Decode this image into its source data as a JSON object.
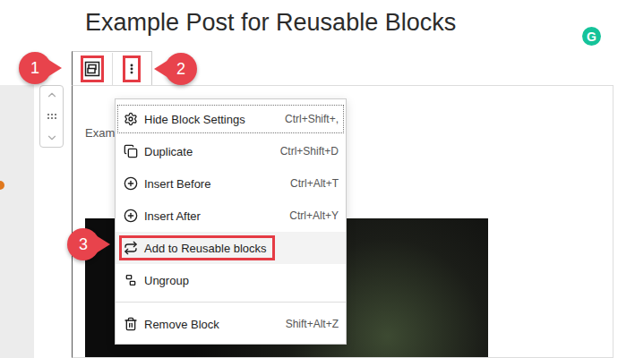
{
  "post": {
    "title": "Example Post for Reusable Blocks"
  },
  "grammarly": {
    "label": "G"
  },
  "toolbar": {
    "buttons": [
      {
        "highlighted": true
      },
      {
        "highlighted": true
      }
    ]
  },
  "block": {
    "text": "Exam"
  },
  "menu": {
    "items": [
      {
        "label": "Hide Block Settings",
        "shortcut": "Ctrl+Shift+,",
        "focused": true,
        "highlighted": false,
        "separator_before": false
      },
      {
        "label": "Duplicate",
        "shortcut": "Ctrl+Shift+D",
        "focused": false,
        "highlighted": false,
        "separator_before": false
      },
      {
        "label": "Insert Before",
        "shortcut": "Ctrl+Alt+T",
        "focused": false,
        "highlighted": false,
        "separator_before": false
      },
      {
        "label": "Insert After",
        "shortcut": "Ctrl+Alt+Y",
        "focused": false,
        "highlighted": false,
        "separator_before": false
      },
      {
        "label": "Add to Reusable blocks",
        "shortcut": "",
        "focused": false,
        "highlighted": true,
        "separator_before": false
      },
      {
        "label": "Ungroup",
        "shortcut": "",
        "focused": false,
        "highlighted": false,
        "separator_before": false
      },
      {
        "label": "Remove Block",
        "shortcut": "Shift+Alt+Z",
        "focused": false,
        "highlighted": false,
        "separator_before": true
      }
    ]
  },
  "callouts": [
    {
      "label": "1"
    },
    {
      "label": "2"
    },
    {
      "label": "3"
    }
  ]
}
